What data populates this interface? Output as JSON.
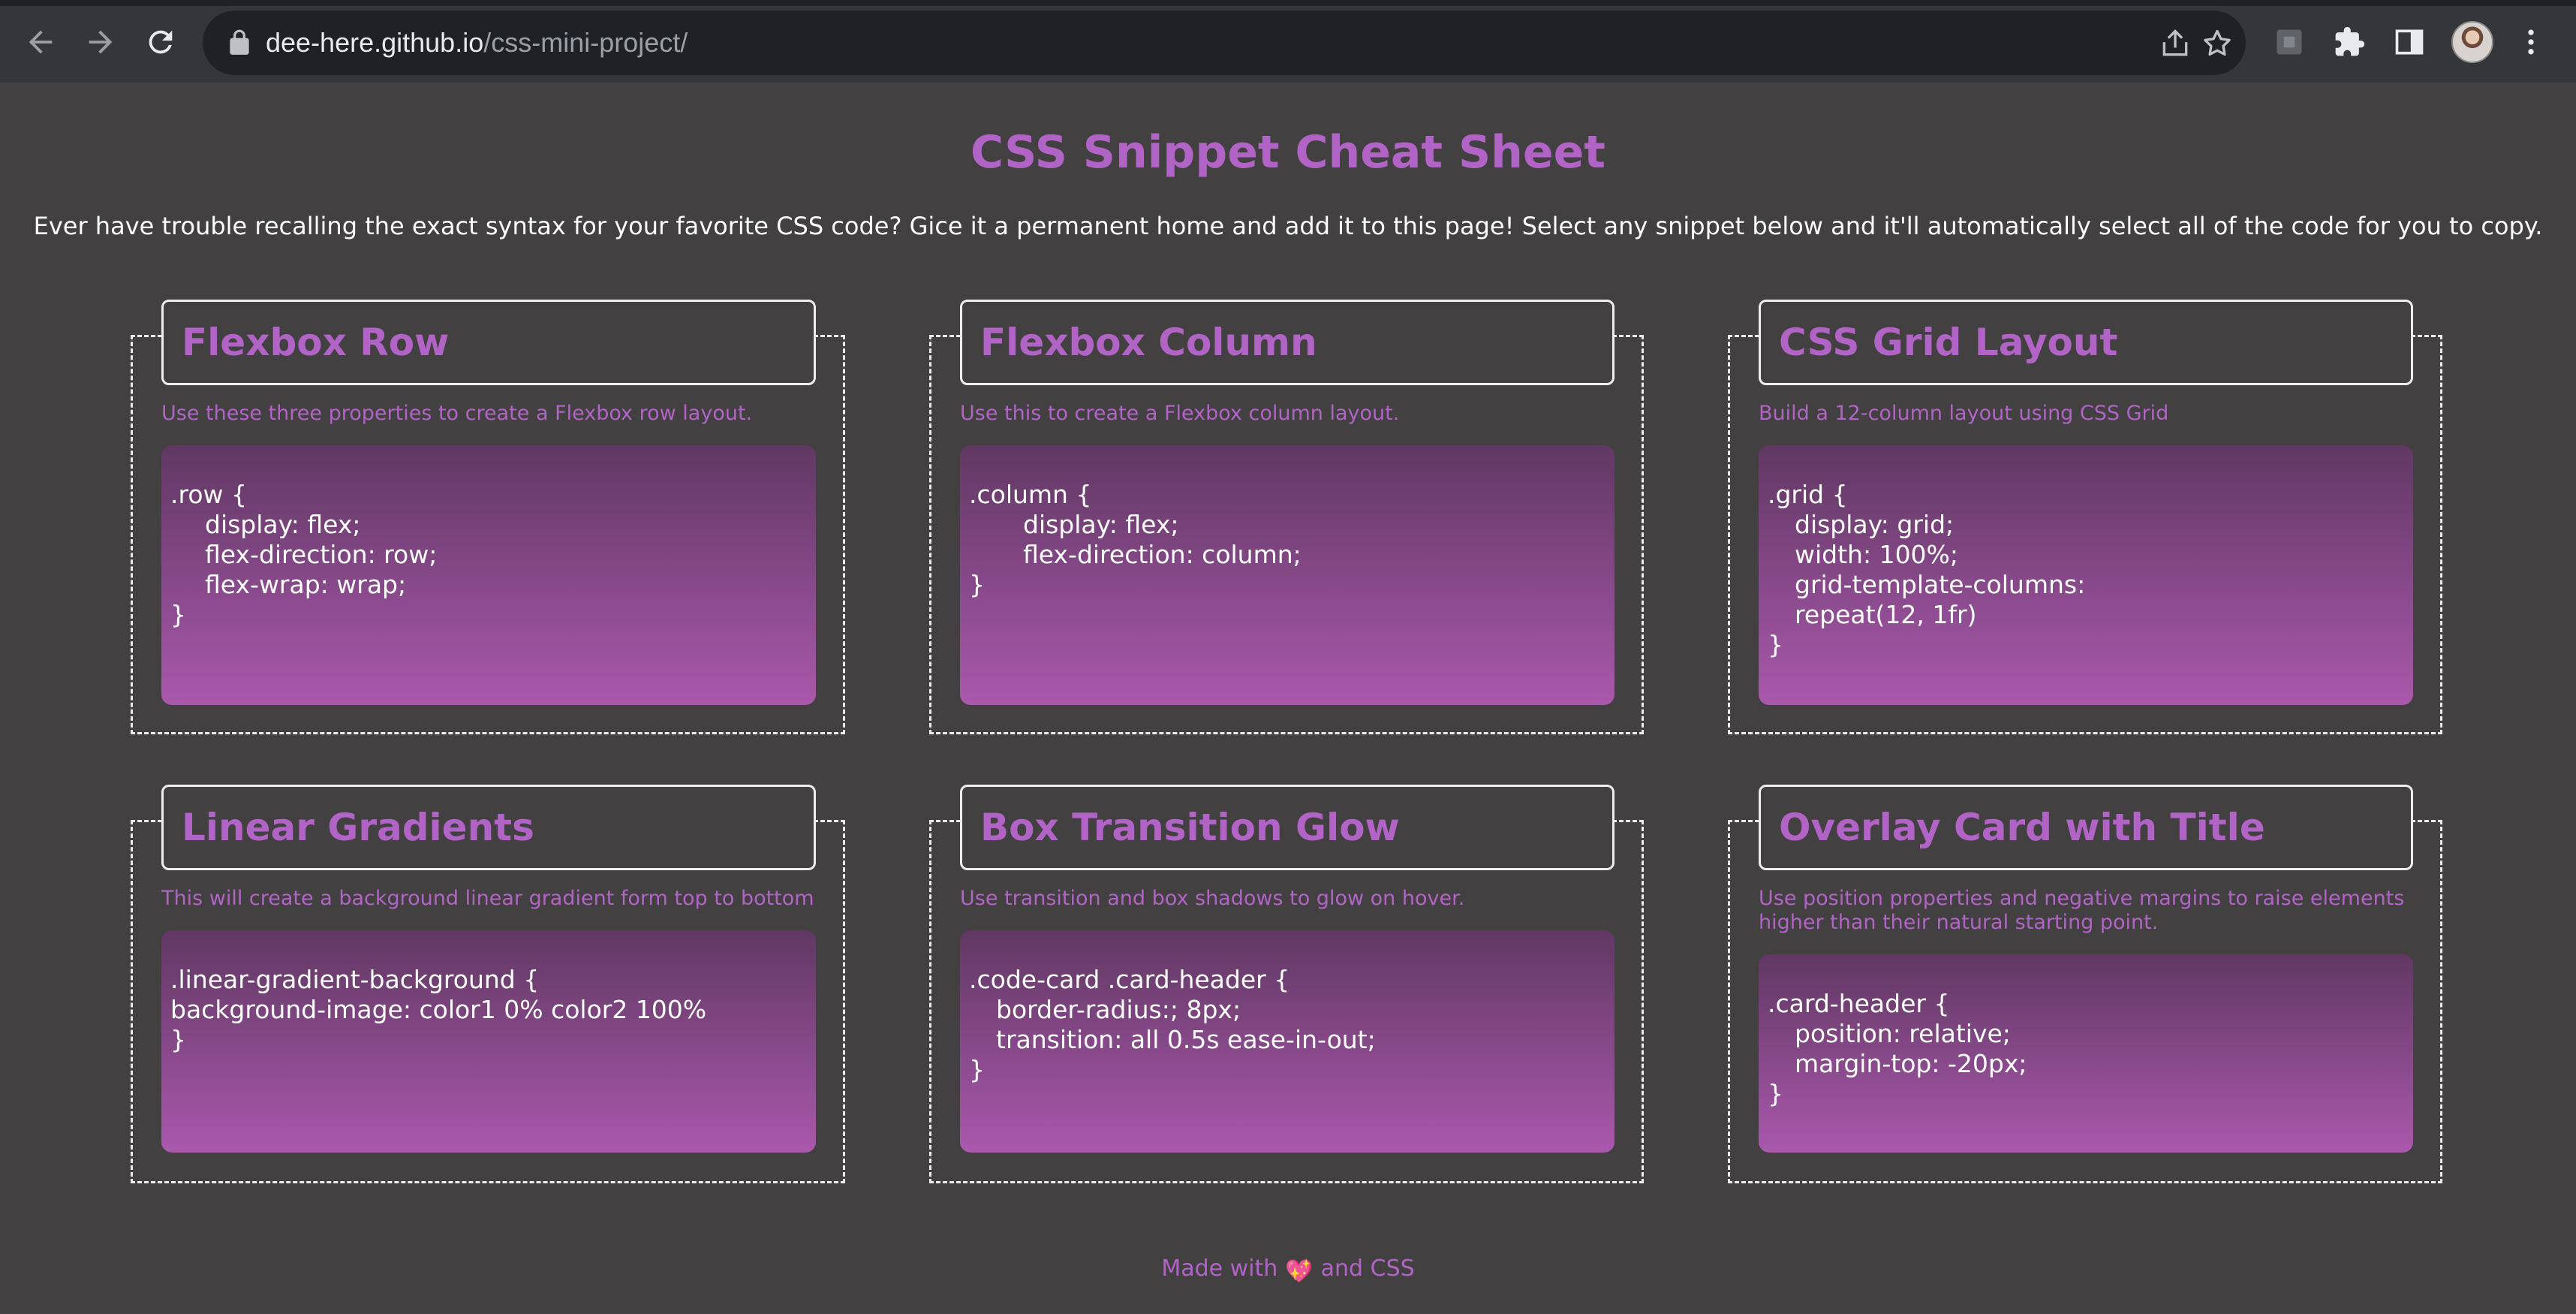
{
  "browser": {
    "url_host": "dee-here.github.io",
    "url_path": "/css-mini-project/",
    "icons": [
      "back-arrow-icon",
      "forward-arrow-icon",
      "reload-icon",
      "lock-icon",
      "share-icon",
      "star-icon",
      "extension-box-icon",
      "puzzle-icon",
      "sidebar-icon",
      "avatar",
      "more-vert-icon"
    ]
  },
  "page": {
    "title": "CSS Snippet Cheat Sheet",
    "intro": "Ever have trouble recalling the exact syntax for your favorite CSS code? Gice it a permanent home and add it to this page! Select any snippet below and it'll automatically select all of the code for you to copy."
  },
  "cards": [
    {
      "title": "Flexbox Row",
      "description": "Use these three properties to create a Flexbox row layout.",
      "code": [
        ".row {",
        "display: flex;",
        "flex-direction: row;",
        "flex-wrap: wrap;",
        "}"
      ]
    },
    {
      "title": "Flexbox Column",
      "description": "Use this to create a Flexbox column layout.",
      "code": [
        ".column {",
        "display: flex;",
        "flex-direction: column;",
        "}"
      ]
    },
    {
      "title": "CSS Grid Layout",
      "description": "Build a 12-column layout using CSS Grid",
      "code": [
        ".grid {",
        "display: grid;",
        "width: 100%;",
        "grid-template-columns:",
        "repeat(12, 1fr)",
        "}"
      ]
    },
    {
      "title": "Linear Gradients",
      "description": "This will create a background linear gradient form top to bottom",
      "code": [
        ".linear-gradient-background {",
        "background-image: color1 0% color2 100%",
        "}"
      ]
    },
    {
      "title": "Box Transition Glow",
      "description": "Use transition and box shadows to glow on hover.",
      "code": [
        ".code-card .card-header {",
        "border-radius:; 8px;",
        "transition: all 0.5s ease-in-out;",
        "}"
      ]
    },
    {
      "title": "Overlay Card with Title",
      "description": "Use position properties and negative margins to raise elements higher than their natural starting point.",
      "code": [
        ".card-header {",
        "position: relative;",
        "margin-top: -20px;",
        "}"
      ]
    }
  ],
  "footer": {
    "prefix": "Made with",
    "heart": "💖",
    "suffix": "and CSS"
  },
  "colors": {
    "accent": "#b264c6",
    "background": "#424041",
    "code_gradient_top": "#603862",
    "code_gradient_bottom": "#aa58ad"
  }
}
